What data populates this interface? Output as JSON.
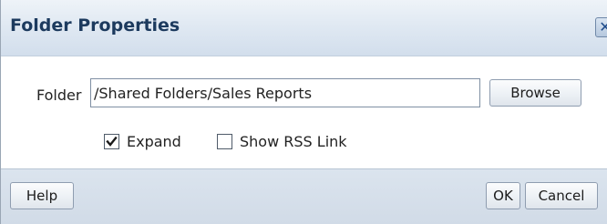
{
  "dialog": {
    "title": "Folder Properties",
    "close_icon": "close-icon",
    "close_glyph": "✕"
  },
  "form": {
    "folder_label": "Folder",
    "folder_value": "/Shared Folders/Sales Reports",
    "browse_label": "Browse",
    "expand_label": "Expand",
    "expand_checked": true,
    "rss_label": "Show RSS Link",
    "rss_checked": false
  },
  "footer": {
    "help_label": "Help",
    "ok_label": "OK",
    "cancel_label": "Cancel"
  },
  "colors": {
    "title_text": "#1c3a5e",
    "titlebar_bg": "#dfe8f2",
    "footer_bg": "#d6dfea"
  }
}
